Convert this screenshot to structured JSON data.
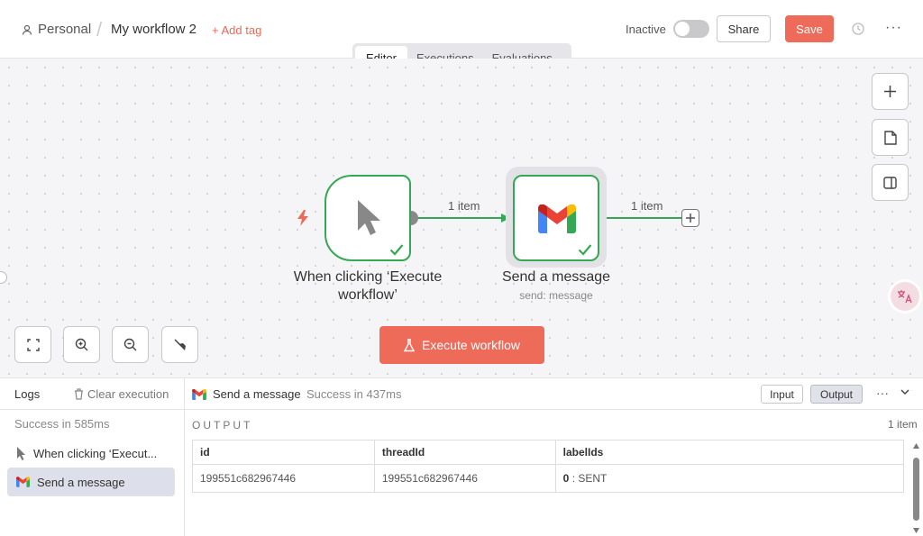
{
  "header": {
    "breadcrumb_personal": "Personal",
    "separator": "/",
    "workflow_name": "My workflow 2",
    "add_tag": "+ Add tag",
    "inactive_label": "Inactive",
    "share_label": "Share",
    "save_label": "Save",
    "more_label": "···"
  },
  "tabs": [
    {
      "label": "Editor",
      "active": true
    },
    {
      "label": "Executions",
      "active": false
    },
    {
      "label": "Evaluations",
      "active": false
    }
  ],
  "canvas": {
    "nodes": [
      {
        "title": "When clicking ‘Execute workflow’",
        "subtitle": "",
        "status": "success"
      },
      {
        "title": "Send a message",
        "subtitle": "send: message",
        "status": "success"
      }
    ],
    "connections": [
      {
        "label": "1 item"
      },
      {
        "label": "1 item"
      }
    ],
    "execute_button": "Execute workflow"
  },
  "logs": {
    "title": "Logs",
    "clear_label": "Clear execution",
    "success_summary": "Success in 585ms",
    "items": [
      {
        "label": "When clicking ‘Execut...",
        "icon": "cursor-icon",
        "selected": false
      },
      {
        "label": "Send a message",
        "icon": "gmail-icon",
        "selected": true
      }
    ],
    "detail": {
      "node_name": "Send a message",
      "status": "Success in 437ms",
      "input_label": "Input",
      "output_label": "Output",
      "more_label": "···",
      "section_label": "OUTPUT",
      "item_count": "1 item",
      "columns": [
        "id",
        "threadId",
        "labelIds"
      ],
      "rows": [
        {
          "id": "199551c682967446",
          "threadId": "199551c682967446",
          "labelIds_index": "0",
          "labelIds_sep": ":",
          "labelIds_value": "SENT"
        }
      ]
    }
  },
  "colors": {
    "accent": "#ee6b5a",
    "success": "#35a855",
    "canvas_bg": "#f5f5f7"
  }
}
